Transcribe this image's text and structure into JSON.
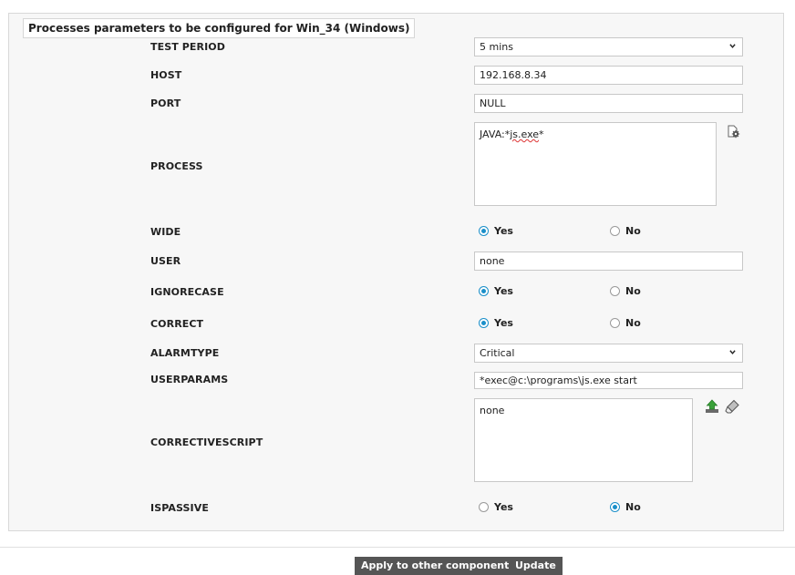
{
  "panel": {
    "title": "Processes parameters to be configured for Win_34 (Windows)"
  },
  "fields": {
    "test_period": {
      "label": "TEST PERIOD",
      "value": "5 mins"
    },
    "host": {
      "label": "HOST",
      "value": "192.168.8.34"
    },
    "port": {
      "label": "PORT",
      "value": "NULL"
    },
    "process": {
      "label": "PROCESS",
      "value_prefix": "JAVA:*",
      "value_spell": "js.exe",
      "value_suffix": "*"
    },
    "wide": {
      "label": "WIDE",
      "yes": "Yes",
      "no": "No",
      "selected": "Yes"
    },
    "user": {
      "label": "USER",
      "value": "none"
    },
    "ignorecase": {
      "label": "IGNORECASE",
      "yes": "Yes",
      "no": "No",
      "selected": "Yes"
    },
    "correct": {
      "label": "CORRECT",
      "yes": "Yes",
      "no": "No",
      "selected": "Yes"
    },
    "alarmtype": {
      "label": "ALARMTYPE",
      "value": "Critical"
    },
    "userparams": {
      "label": "USERPARAMS",
      "value": "*exec@c:\\programs\\js.exe start"
    },
    "correctivescript": {
      "label": "CORRECTIVESCRIPT",
      "value": "none"
    },
    "ispassive": {
      "label": "ISPASSIVE",
      "yes": "Yes",
      "no": "No",
      "selected": "No"
    }
  },
  "icons": {
    "process_config": "gear-document-icon",
    "upload": "upload-icon",
    "eraser": "eraser-icon",
    "accent": "#1a8fc9"
  },
  "buttons": {
    "apply": "Apply to other components",
    "update": "Update"
  }
}
